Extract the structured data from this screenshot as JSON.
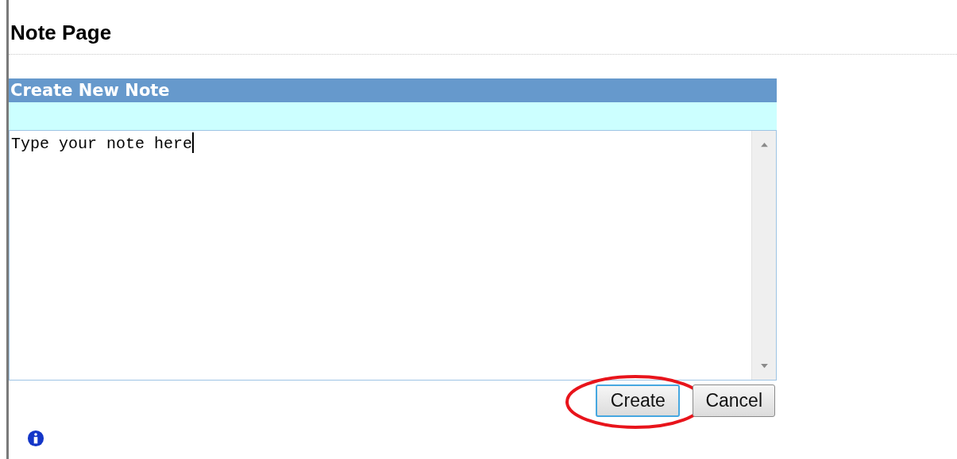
{
  "page": {
    "title": "Note Page"
  },
  "panel": {
    "title": "Create New Note",
    "note_value": "Type your note here"
  },
  "buttons": [
    {
      "label": "Create",
      "focused": true,
      "highlighted": true
    },
    {
      "label": "Cancel",
      "focused": false,
      "highlighted": false
    }
  ]
}
